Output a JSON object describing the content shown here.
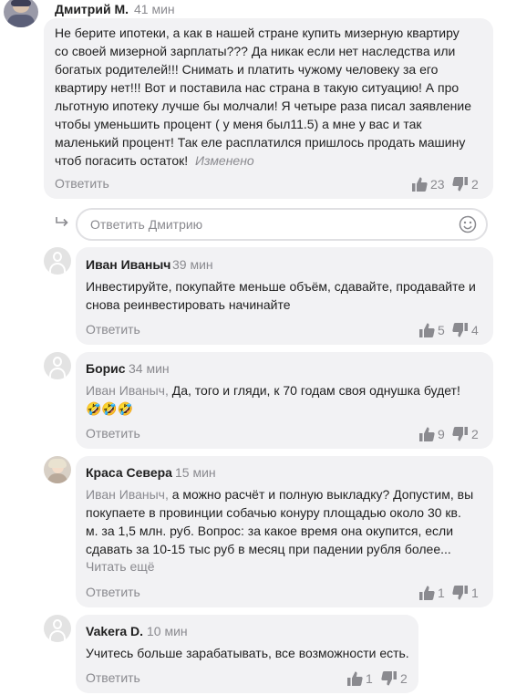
{
  "comments": [
    {
      "author": "Дмитрий М.",
      "time": "41 мин",
      "lines": [
        "Не берите ипотеки, а как в нашей стране купить мизерную квартиру",
        "со своей мизерной зарплаты??? Да никак если нет наследства или",
        "богатых родителей!!! Снимать и платить чужому человеку за его",
        "квартиру нет!!! Вот и поставила нас страна в такую ситуацию! А про",
        "льготную ипотеку лучше бы молчали! Я четыре раза писал заявление",
        "чтобы уменьшить процент ( у меня был11.5) а мне у вас и так",
        "маленький процент! Так еле расплатился пришлось продать машину",
        "чтоб погасить остаток!"
      ],
      "edited": "Изменено",
      "reply": "Ответить",
      "likes": "23",
      "dislikes": "2"
    },
    {
      "author": "Иван Иваныч",
      "time": "39 мин",
      "lines": [
        "Инвестируйте, покупайте меньше объём, сдавайте, продавайте и",
        "снова реинвестировать начинайте"
      ],
      "reply": "Ответить",
      "likes": "5",
      "dislikes": "4"
    },
    {
      "author": "Борис",
      "time": "34 мин",
      "mention": "Иван Иваныч,",
      "lines": [
        " Да, того и гляди, к 70 годам своя однушка будет!",
        "🤣🤣🤣"
      ],
      "reply": "Ответить",
      "likes": "9",
      "dislikes": "2"
    },
    {
      "author": "Краса Севера",
      "time": "15 мин",
      "mention": "Иван Иваныч,",
      "lines": [
        " а можно расчёт и полную выкладку? Допустим, вы",
        "покупаете в провинции собачью конуру площадью около 30 кв.",
        "м. за 1,5 млн. руб. Вопрос: за какое время она окупится, если",
        "сдавать за 10-15 тыс руб в месяц при падении рубля более..."
      ],
      "read_more": "Читать ещё",
      "reply": "Ответить",
      "likes": "1",
      "dislikes": "1"
    },
    {
      "author": "Vakera D.",
      "time": "10 мин",
      "lines": [
        "Учитесь больше зарабатывать, все возможности есть."
      ],
      "reply": "Ответить",
      "likes": "1",
      "dislikes": "2"
    }
  ],
  "reply_box": {
    "placeholder": "Ответить Дмитрию"
  },
  "icons": {
    "like": "thumbs-up-icon",
    "dislike": "thumbs-down-icon",
    "emoji": "smiley-icon",
    "reply_arrow": "reply-arrow-icon"
  },
  "colors": {
    "bubble": "#f2f2f4",
    "muted": "#8a8a8f",
    "text": "#1f1f1f"
  }
}
